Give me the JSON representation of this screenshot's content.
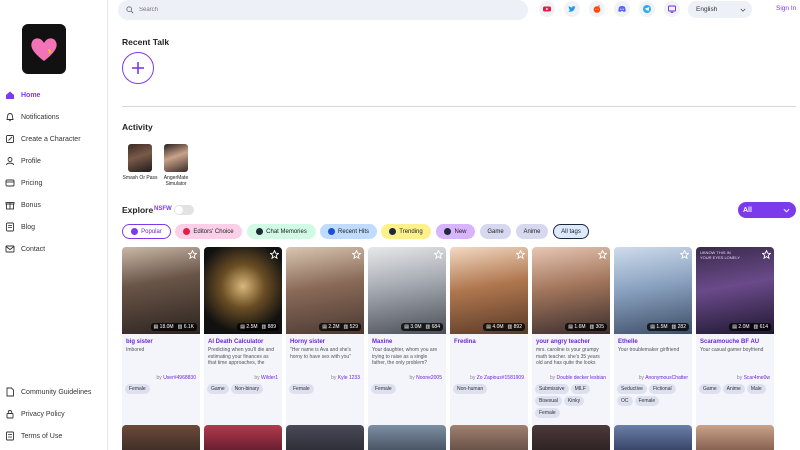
{
  "sidebar": {
    "nav": [
      {
        "label": "Home",
        "icon": "home-icon",
        "active": true
      },
      {
        "label": "Notifications",
        "icon": "bell-icon"
      },
      {
        "label": "Create a Character",
        "icon": "edit-icon"
      },
      {
        "label": "Profile",
        "icon": "user-icon"
      },
      {
        "label": "Pricing",
        "icon": "pricing-icon"
      },
      {
        "label": "Bonus",
        "icon": "gift-icon"
      },
      {
        "label": "Blog",
        "icon": "blog-icon"
      },
      {
        "label": "Contact",
        "icon": "mail-icon"
      }
    ],
    "bottom": [
      {
        "label": "Community Guidelines",
        "icon": "document-icon"
      },
      {
        "label": "Privacy Policy",
        "icon": "lock-icon"
      },
      {
        "label": "Terms of Use",
        "icon": "list-icon"
      }
    ]
  },
  "topbar": {
    "search_placeholder": "Search",
    "socials": [
      "youtube-icon",
      "twitter-icon",
      "reddit-icon",
      "discord-icon",
      "telegram-icon",
      "tv-icon"
    ],
    "language": "English",
    "signin": "Sign In"
  },
  "main": {
    "recent_talk_title": "Recent Talk",
    "activity_title": "Activity",
    "activities": [
      {
        "label": "Smash Or Pass"
      },
      {
        "label": "AngerMate Simulator"
      }
    ],
    "explore_title": "Explore",
    "nsfw_label": "NSFW",
    "filter_all": "All",
    "tags": [
      {
        "label": "Popular",
        "icon": "heart-icon"
      },
      {
        "label": "Editors' Choice",
        "icon": "star-icon"
      },
      {
        "label": "Chat Memories",
        "icon": "chat-icon"
      },
      {
        "label": "Recent Hits",
        "icon": "check-icon"
      },
      {
        "label": "Trending",
        "icon": "flame-icon"
      },
      {
        "label": "New",
        "icon": "bulb-icon"
      },
      {
        "label": "Game",
        "icon": ""
      },
      {
        "label": "Anime",
        "icon": ""
      },
      {
        "label": "All tags",
        "icon": ""
      }
    ],
    "cards": [
      {
        "name": "big sister",
        "desc": "Imbored",
        "by": "User#4968830",
        "chats": "18.0M",
        "memories": "6.1K",
        "tags": [
          "Female"
        ]
      },
      {
        "name": "AI Death Calculator",
        "desc": "Predicting when you'll die and estimating your finances as that time approaches, the",
        "by": "Wilder1",
        "chats": "2.5M",
        "memories": "889",
        "tags": [
          "Game",
          "Non-binary"
        ]
      },
      {
        "name": "Horny sister",
        "desc": "\"Her name is Ava and she's horny to have sex with you\"",
        "by": "Kyle 1233",
        "chats": "2.2M",
        "memories": "529",
        "tags": [
          "Female"
        ]
      },
      {
        "name": "Maxine",
        "desc": "Your daughter, whom you are trying to raise as a single father, the only problem?",
        "by": "Noone2005",
        "chats": "3.0M",
        "memories": "684",
        "tags": [
          "Female"
        ]
      },
      {
        "name": "Fredina",
        "desc": "",
        "by": "Zo Zapious#1581909",
        "chats": "4.0M",
        "memories": "892",
        "tags": [
          "Non-human"
        ]
      },
      {
        "name": "your angry teacher",
        "desc": "mrs. caroline is your grumpy math teacher. she's 35 years old and has quite the looks",
        "by": "Double decker lesbian",
        "chats": "1.6M",
        "memories": "305",
        "tags": [
          "Submissive",
          "MILF",
          "Bisexual",
          "Kinky",
          "Female"
        ]
      },
      {
        "name": "Ethelle",
        "desc": "Your troublemaker girlfriend",
        "by": "AnonymousChatter",
        "chats": "1.5M",
        "memories": "282",
        "tags": [
          "Seductive",
          "Fictional",
          "OC",
          "Female"
        ]
      },
      {
        "name": "Scaramouche BF AU",
        "desc": "Your casual gamer boyfriend",
        "by": "Scar4me0w",
        "chats": "2.0M",
        "memories": "614",
        "tags": [
          "Game",
          "Anime",
          "Male"
        ]
      }
    ],
    "card_overlay_text": "UKNOW THIS IN YOUR EYES LONELY",
    "by_prefix": "by"
  }
}
